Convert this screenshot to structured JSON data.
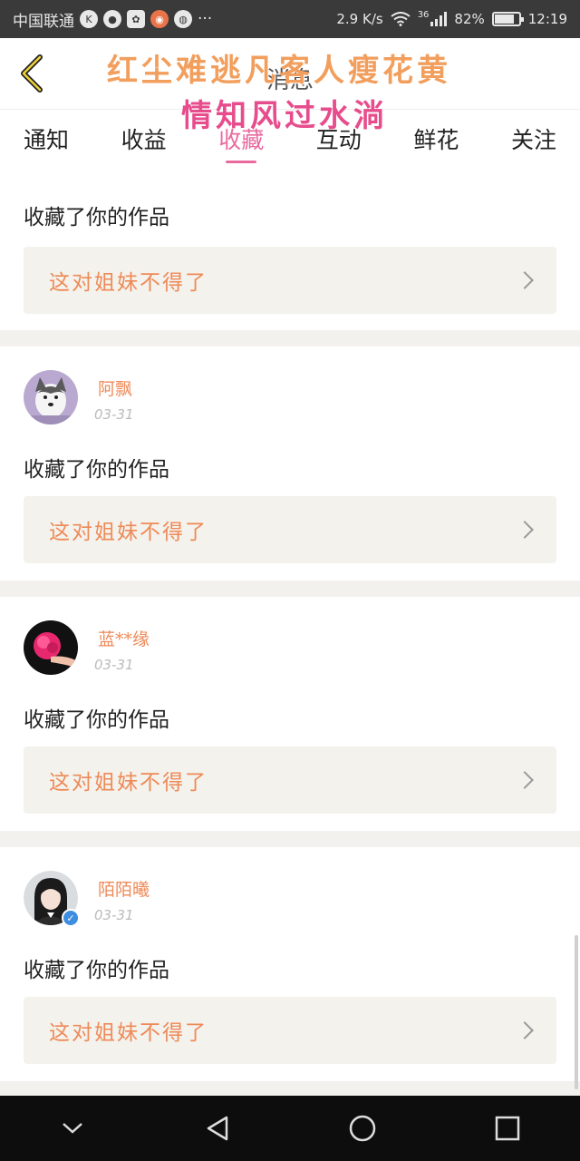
{
  "status_bar": {
    "carrier": "中国联通",
    "net_speed": "2.9 K/s",
    "signal": "36",
    "battery": "82%",
    "battery_level": 0.82,
    "time": "12:19",
    "more": "···"
  },
  "header": {
    "title": "消息",
    "overlay_line1": "红尘难逃凡客人瘦花黄",
    "overlay_line2": "情知风过水淌"
  },
  "tabs": [
    {
      "label": "通知",
      "active": false
    },
    {
      "label": "收益",
      "active": false
    },
    {
      "label": "收藏",
      "active": true
    },
    {
      "label": "互动",
      "active": false
    },
    {
      "label": "鲜花",
      "active": false
    },
    {
      "label": "关注",
      "active": false
    }
  ],
  "notifications": [
    {
      "username": "",
      "date": "",
      "action": "收藏了你的作品",
      "work_title": "这对姐妹不得了"
    },
    {
      "username": "阿飘",
      "date": "03-31",
      "action": "收藏了你的作品",
      "work_title": "这对姐妹不得了"
    },
    {
      "username": "蓝**缘",
      "date": "03-31",
      "action": "收藏了你的作品",
      "work_title": "这对姐妹不得了"
    },
    {
      "username": "陌陌曦",
      "date": "03-31",
      "action": "收藏了你的作品",
      "work_title": "这对姐妹不得了",
      "verified": true
    }
  ],
  "colors": {
    "accent_pink": "#e96aa0",
    "accent_orange": "#ee8a58"
  }
}
